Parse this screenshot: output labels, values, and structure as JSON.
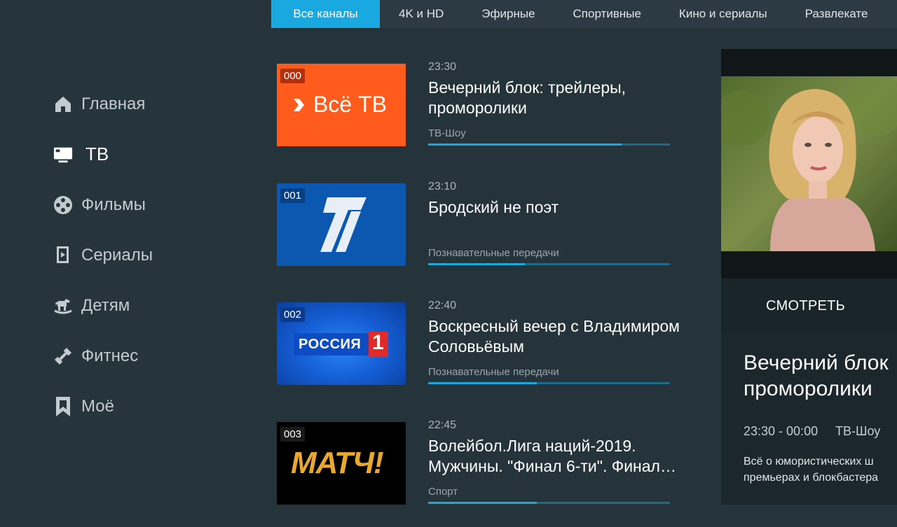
{
  "sidebar": {
    "items": [
      {
        "label": "Главная",
        "icon": "home-icon"
      },
      {
        "label": "ТВ",
        "icon": "tv-icon",
        "active": true
      },
      {
        "label": "Фильмы",
        "icon": "film-reel-icon"
      },
      {
        "label": "Сериалы",
        "icon": "series-icon"
      },
      {
        "label": "Детям",
        "icon": "rocking-horse-icon"
      },
      {
        "label": "Фитнес",
        "icon": "dumbbell-icon"
      },
      {
        "label": "Моё",
        "icon": "bookmark-icon"
      }
    ]
  },
  "tabs": [
    "Все каналы",
    "4K и HD",
    "Эфирные",
    "Спортивные",
    "Кино и сериалы",
    "Развлекате"
  ],
  "channels": [
    {
      "number": "000",
      "logo_text": "Всё ТВ",
      "time": "23:30",
      "title": "Вечерний блок: трейлеры, проморолики",
      "genre": "ТВ-Шоу",
      "progress": 0.8
    },
    {
      "number": "001",
      "logo_text": "1",
      "time": "23:10",
      "title": "Бродский не поэт",
      "genre": "Познавательные передачи",
      "progress": 0.4
    },
    {
      "number": "002",
      "logo_text": "РОССИЯ",
      "logo_text_2": "1",
      "time": "22:40",
      "title": "Воскресный вечер с Владимиром Соловьёвым",
      "genre": "Познавательные передачи",
      "progress": 0.45
    },
    {
      "number": "003",
      "logo_text": "МАТЧ!",
      "time": "22:45",
      "title": "Волейбол.Лига наций-2019. Мужчины. \"Финал 6-ти\". Финал…",
      "genre": "Спорт",
      "progress": 0.45
    }
  ],
  "detail": {
    "watch_label": "СМОТРЕТЬ",
    "title_line1": "Вечерний блок",
    "title_line2": "проморолики",
    "time_range": "23:30 - 00:00",
    "genre": "ТВ-Шоу",
    "desc_line1": "Всё о юмористических ш",
    "desc_line2": "премьерах и блокбастера"
  },
  "colors": {
    "accent": "#1aa8e0",
    "background": "#25333b",
    "vse_tv_orange": "#fe5b1c",
    "perviy_blue": "#0c58b0",
    "rossiya_blue": "#1660d8",
    "match_gold": "#e9a92e"
  }
}
